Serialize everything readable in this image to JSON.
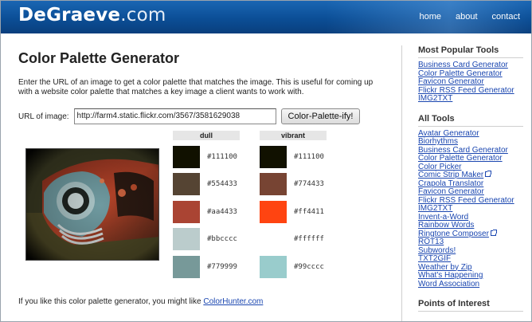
{
  "header": {
    "logo_main": "DeGraeve",
    "logo_suffix": ".com",
    "nav": [
      "home",
      "about",
      "contact"
    ]
  },
  "main": {
    "title": "Color Palette Generator",
    "intro": "Enter the URL of an image to get a color palette that matches the image. This is useful for coming up with a website color palette that matches a key image a client wants to work with.",
    "url_label": "URL of image:",
    "url_value": "http://farm4.static.flickr.com/3567/3581629038",
    "submit_label": "Color-Palette-ify!",
    "dull_label": "dull",
    "vibrant_label": "vibrant",
    "dull": [
      {
        "hex": "#111100",
        "color": "#111100"
      },
      {
        "hex": "#554433",
        "color": "#554433"
      },
      {
        "hex": "#aa4433",
        "color": "#aa4433"
      },
      {
        "hex": "#bbcccc",
        "color": "#bbcccc"
      },
      {
        "hex": "#779999",
        "color": "#779999"
      }
    ],
    "vibrant": [
      {
        "hex": "#111100",
        "color": "#111100"
      },
      {
        "hex": "#774433",
        "color": "#774433"
      },
      {
        "hex": "#ff4411",
        "color": "#ff4411"
      },
      {
        "hex": "#ffffff",
        "color": "#ffffff"
      },
      {
        "hex": "#99cccc",
        "color": "#99cccc"
      }
    ],
    "footer_text": "If you like this color palette generator, you might like ",
    "footer_link": "ColorHunter.com"
  },
  "sidebar": {
    "popular_title": "Most Popular Tools",
    "popular": [
      "Business Card Generator",
      "Color Palette Generator",
      "Favicon Generator",
      "Flickr RSS Feed Generator",
      "IMG2TXT"
    ],
    "all_title": "All Tools",
    "all": [
      {
        "label": "Avatar Generator",
        "ext": false
      },
      {
        "label": "Biorhythms",
        "ext": false
      },
      {
        "label": "Business Card Generator",
        "ext": false
      },
      {
        "label": "Color Palette Generator",
        "ext": false
      },
      {
        "label": "Color Picker",
        "ext": false
      },
      {
        "label": "Comic Strip Maker",
        "ext": true
      },
      {
        "label": "Crapola Translator",
        "ext": false
      },
      {
        "label": "Favicon Generator",
        "ext": false
      },
      {
        "label": "Flickr RSS Feed Generator",
        "ext": false
      },
      {
        "label": "IMG2TXT",
        "ext": false
      },
      {
        "label": "Invent-a-Word",
        "ext": false
      },
      {
        "label": "Rainbow Words",
        "ext": false
      },
      {
        "label": "Ringtone Composer",
        "ext": true
      },
      {
        "label": "ROT13",
        "ext": false
      },
      {
        "label": "Subwords!",
        "ext": false
      },
      {
        "label": "TXT2GIF",
        "ext": false
      },
      {
        "label": "Weather by Zip",
        "ext": false
      },
      {
        "label": "What's Happening",
        "ext": false
      },
      {
        "label": "Word Association",
        "ext": false
      }
    ],
    "poi_title": "Points of Interest"
  },
  "icons": {
    "external": "external-link-icon"
  },
  "colors": {
    "header_blue": "#0b4e96",
    "link_blue": "#1a46b0"
  }
}
